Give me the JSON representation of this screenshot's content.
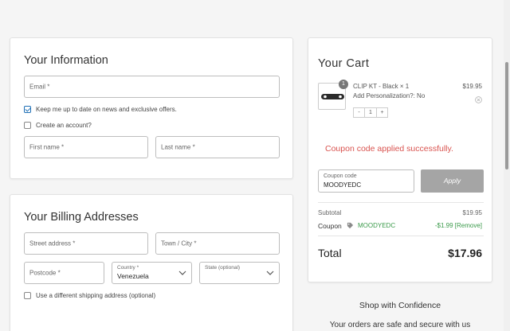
{
  "info": {
    "title": "Your Information",
    "email_placeholder": "Email *",
    "keep_me_label": "Keep me up to date on news and exclusive offers.",
    "create_account_label": "Create an account?",
    "first_name_placeholder": "First name *",
    "last_name_placeholder": "Last name *"
  },
  "billing": {
    "title": "Your Billing Addresses",
    "street_placeholder": "Street address *",
    "city_placeholder": "Town / City *",
    "postcode_placeholder": "Postcode *",
    "country_label": "Country *",
    "country_value": "Venezuela",
    "state_label": "State (optional)",
    "different_shipping_label": "Use a different shipping address (optional)"
  },
  "cart": {
    "title": "Your Cart",
    "item": {
      "badge": "1",
      "name": "CLIP KT - Black × 1",
      "personalization": "Add Personalization?: No",
      "price": "$19.95",
      "qty_minus": "-",
      "qty_value": "1",
      "qty_plus": "+"
    },
    "coupon_success": "Coupon code applied successfully.",
    "coupon_label": "Coupon code",
    "coupon_value": "MOODYEDC",
    "apply_label": "Apply",
    "subtotal_label": "Subtotal",
    "subtotal_value": "$19.95",
    "coupon_row_label": "Coupon",
    "coupon_code": "MOODYEDC",
    "coupon_discount": "-$1.99",
    "remove_label": "[Remove]",
    "total_label": "Total",
    "total_value": "$17.96"
  },
  "confidence": {
    "title": "Shop with Confidence",
    "text": "Your orders are safe and secure with us"
  },
  "colors": {
    "error_red": "#d9534f",
    "success_green": "#3a9a4a",
    "apply_bg": "#a5a5a5",
    "checkbox_blue": "#1f6fb5"
  }
}
